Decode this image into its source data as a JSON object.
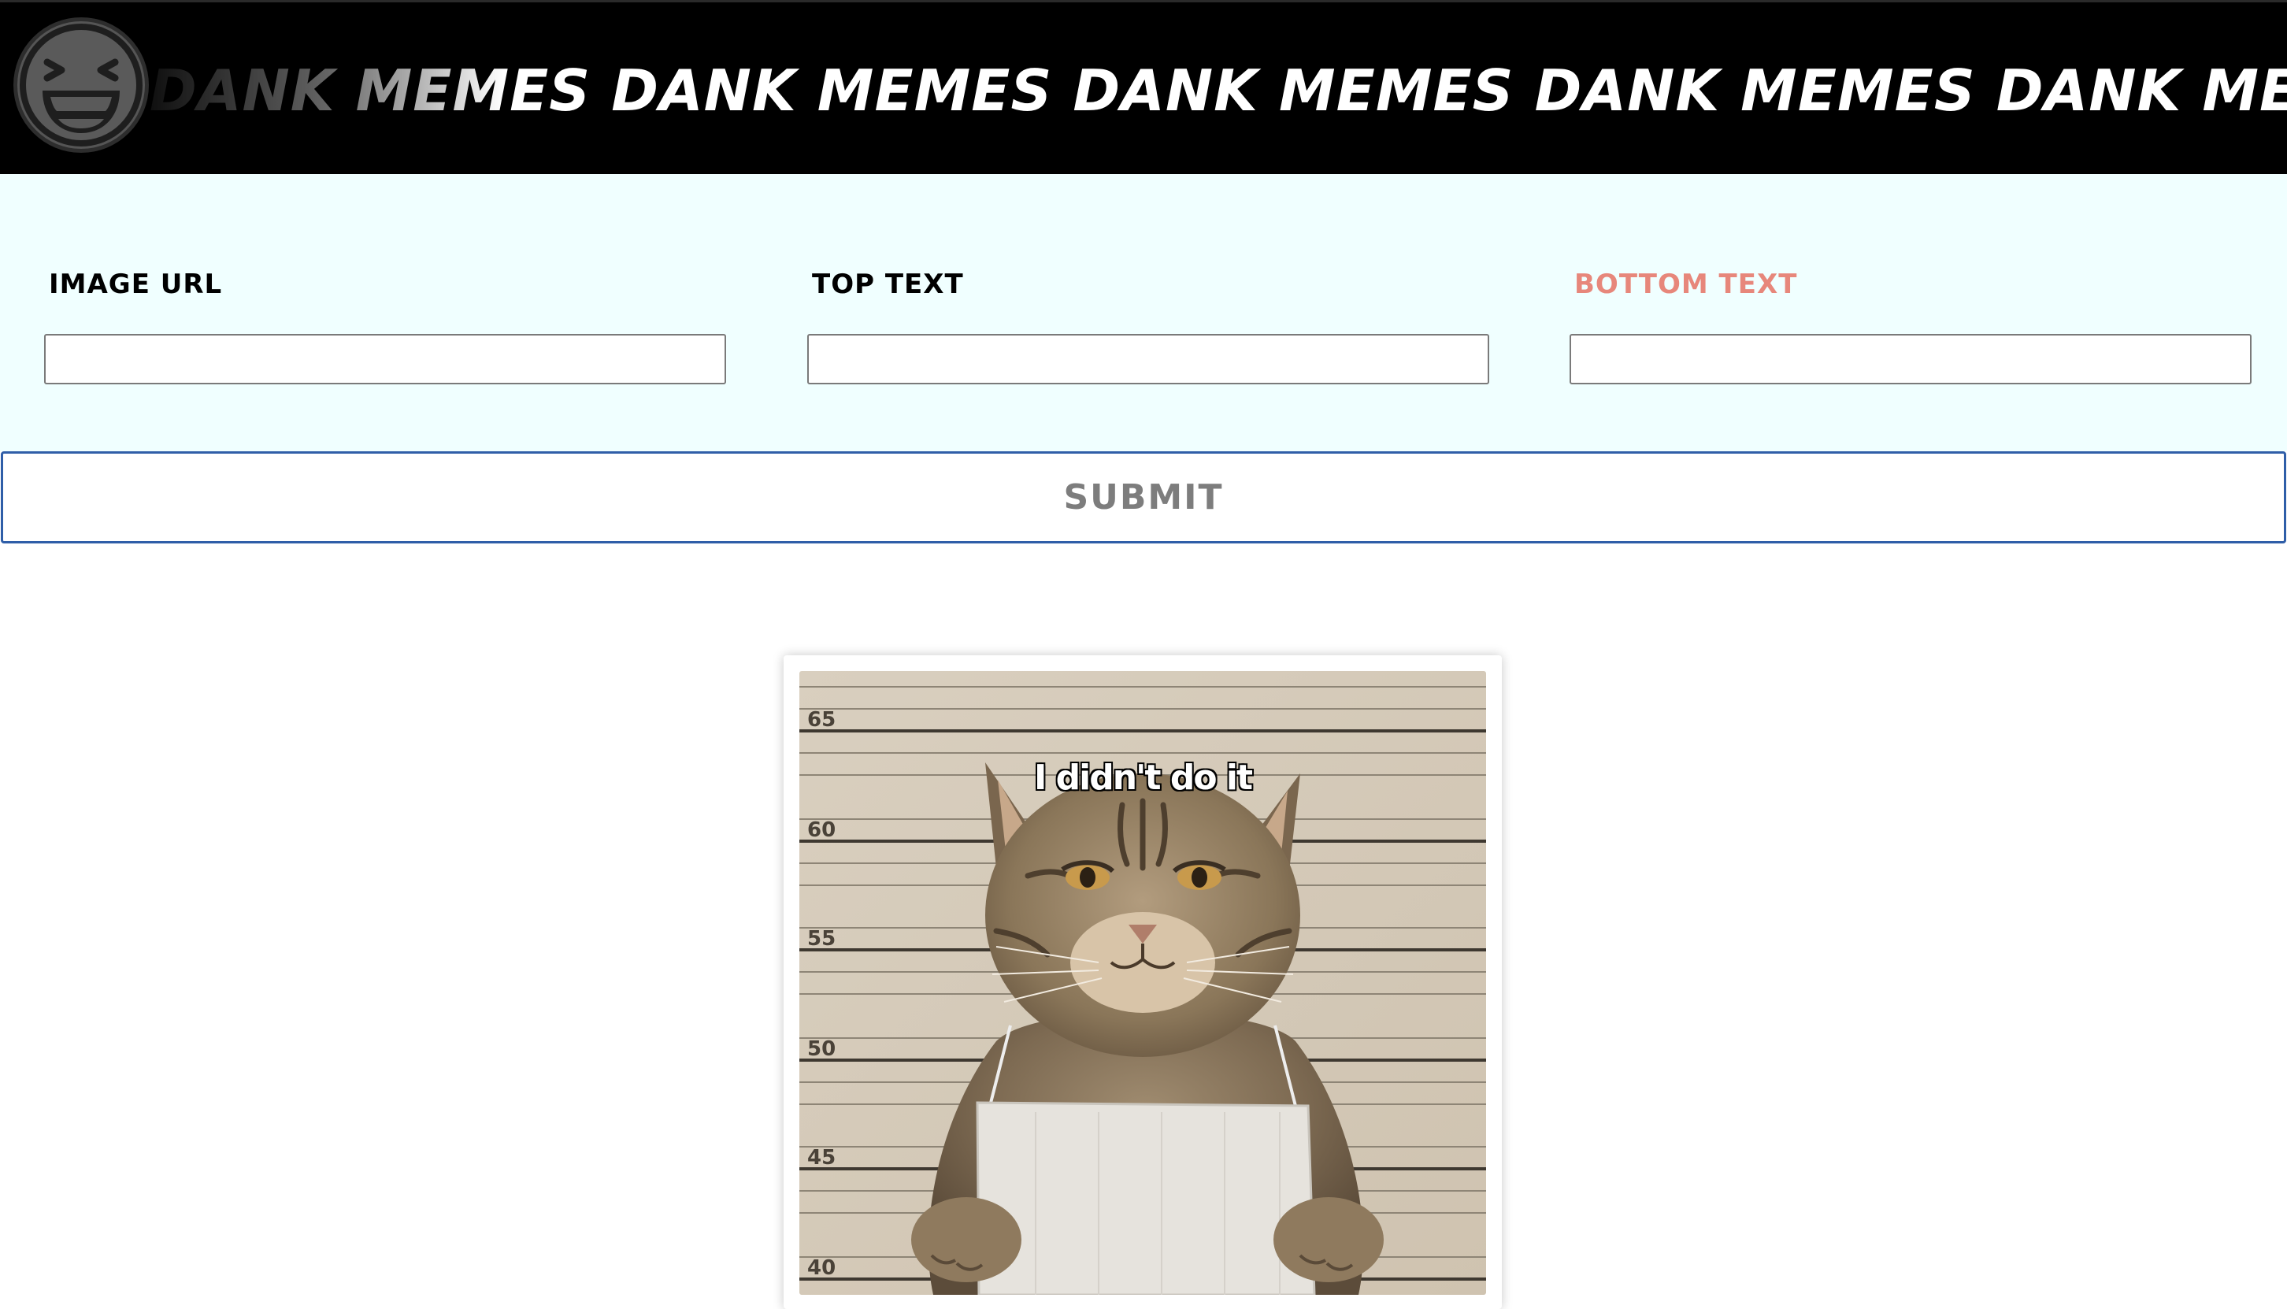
{
  "header": {
    "marquee_text": "DANK MEMES DANK MEMES DANK MEMES   DANK MEMES DANK MEMEZ DANK MEMES",
    "logo_icon": "laughing-face-icon"
  },
  "form": {
    "image_url": {
      "label": "IMAGE URL",
      "value": "",
      "placeholder": ""
    },
    "top_text": {
      "label": "TOP TEXT",
      "value": "",
      "placeholder": ""
    },
    "bottom_text": {
      "label": "BOTTOM TEXT",
      "value": "",
      "placeholder": ""
    },
    "submit_label": "SUBMIT"
  },
  "meme": {
    "top_text": "I didn't do it",
    "bottom_text": "",
    "height_marks": [
      "65",
      "60",
      "55",
      "50",
      "45",
      "40"
    ]
  },
  "colors": {
    "banner_background": "#000000",
    "form_background": "#f0ffff",
    "accent_label": "#e7877b",
    "submit_border": "#2f5ea8",
    "submit_text": "#7d7d7d"
  }
}
